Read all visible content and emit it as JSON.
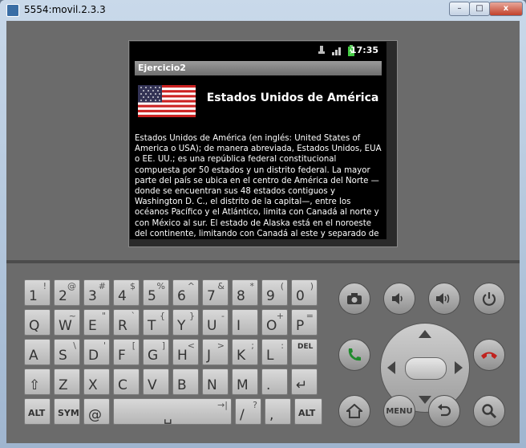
{
  "window": {
    "title": "5554:movil.2.3.3",
    "minimize": "–",
    "maximize": "□",
    "close": "x"
  },
  "status_bar": {
    "time": "17:35"
  },
  "app": {
    "title": "Ejercicio2",
    "heading": "Estados Unidos de América",
    "description": "Estados Unidos de América (en inglés: United States of America o USA); de manera abreviada, Estados Unidos, EUA o EE. UU.; es una república federal constitucional compuesta por 50 estados y un distrito federal. La mayor parte del país se ubica en el centro de América del Norte —donde se encuentran sus 48 estados contiguos y Washington D. C., el distrito de la capital—, entre los océanos Pacífico y el Atlántico, limita con Canadá al norte y con México al sur. El estado de Alaska está en el noroeste del continente, limitando con Canadá al este y separado de Rusia al oeste por el estrecho de Bering. El estado de Hawái es un"
  },
  "keyboard": {
    "row1": [
      {
        "main": "1",
        "alt": "!"
      },
      {
        "main": "2",
        "alt": "@"
      },
      {
        "main": "3",
        "alt": "#"
      },
      {
        "main": "4",
        "alt": "$"
      },
      {
        "main": "5",
        "alt": "%"
      },
      {
        "main": "6",
        "alt": "^"
      },
      {
        "main": "7",
        "alt": "&"
      },
      {
        "main": "8",
        "alt": "*"
      },
      {
        "main": "9",
        "alt": "("
      },
      {
        "main": "0",
        "alt": ")"
      }
    ],
    "row2": [
      {
        "main": "Q",
        "alt": ""
      },
      {
        "main": "W",
        "alt": "~"
      },
      {
        "main": "E",
        "alt": "\""
      },
      {
        "main": "R",
        "alt": "`"
      },
      {
        "main": "T",
        "alt": "{"
      },
      {
        "main": "Y",
        "alt": "}"
      },
      {
        "main": "U",
        "alt": "-"
      },
      {
        "main": "I",
        "alt": ""
      },
      {
        "main": "O",
        "alt": "+"
      },
      {
        "main": "P",
        "alt": "="
      }
    ],
    "row3": [
      {
        "main": "A",
        "alt": ""
      },
      {
        "main": "S",
        "alt": "\\"
      },
      {
        "main": "D",
        "alt": "'"
      },
      {
        "main": "F",
        "alt": "["
      },
      {
        "main": "G",
        "alt": "]"
      },
      {
        "main": "H",
        "alt": "<"
      },
      {
        "main": "J",
        "alt": ">"
      },
      {
        "main": "K",
        "alt": ";"
      },
      {
        "main": "L",
        "alt": ":"
      },
      {
        "main": "DEL",
        "alt": ""
      }
    ],
    "row4": [
      {
        "main": "⇧",
        "alt": ""
      },
      {
        "main": "Z",
        "alt": ""
      },
      {
        "main": "X",
        "alt": ""
      },
      {
        "main": "C",
        "alt": ""
      },
      {
        "main": "V",
        "alt": ""
      },
      {
        "main": "B",
        "alt": ""
      },
      {
        "main": "N",
        "alt": ""
      },
      {
        "main": "M",
        "alt": ""
      },
      {
        "main": ".",
        "alt": ""
      },
      {
        "main": "↵",
        "alt": ""
      }
    ],
    "row5": [
      {
        "main": "ALT",
        "alt": ""
      },
      {
        "main": "SYM",
        "alt": ""
      },
      {
        "main": "@",
        "alt": ""
      },
      {
        "main": "␣",
        "alt": "→|"
      },
      {
        "main": "/",
        "alt": "?"
      },
      {
        "main": ",",
        "alt": ""
      },
      {
        "main": "ALT",
        "alt": ""
      }
    ]
  },
  "controls": {
    "menu_label": "MENU"
  }
}
